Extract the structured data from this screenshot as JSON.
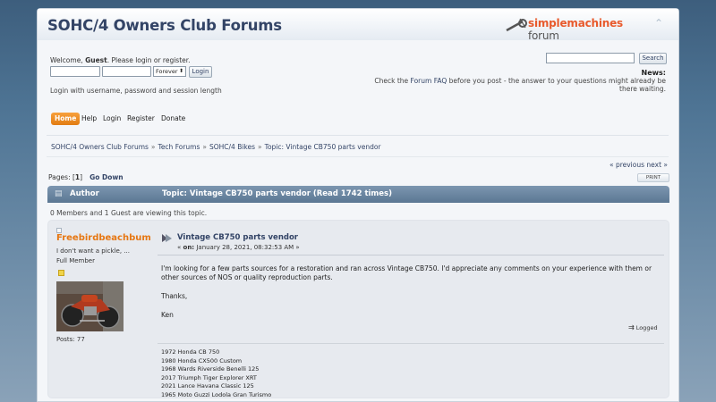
{
  "header": {
    "forum_title": "SOHC/4 Owners Club Forums",
    "logo_simple": "simple",
    "logo_machines": "machines",
    "logo_forum": " forum"
  },
  "user": {
    "welcome_prefix": "Welcome, ",
    "welcome_user": "Guest",
    "welcome_suffix": ". Please login or register.",
    "session_select": "Forever",
    "login_button": "Login",
    "session_note": "Login with username, password and session length"
  },
  "search": {
    "button": "Search"
  },
  "news": {
    "title": "News:",
    "text_1": "Check the ",
    "link": "Forum FAQ",
    "text_2": " before you post - the answer to your questions might already be there waiting."
  },
  "menu": {
    "items": [
      "Home",
      "Help",
      "Login",
      "Register",
      "Donate"
    ]
  },
  "breadcrumb": {
    "items": [
      "SOHC/4 Owners Club Forums",
      "Tech Forums",
      "SOHC/4 Bikes",
      "Topic: Vintage CB750 parts vendor"
    ],
    "sep": "»"
  },
  "nav": {
    "prev": "« previous",
    "next": "next »",
    "pages_label": "Pages: [",
    "current_page": "1",
    "pages_close": "]",
    "go_down": "Go Down",
    "print": "PRINT"
  },
  "topic_header": {
    "author_label": "Author",
    "topic_label": "Topic: Vintage CB750 parts vendor  (Read 1742 times)"
  },
  "viewing": "0 Members and 1 Guest are viewing this topic.",
  "post": {
    "poster_name": "Freebirdbeachbum",
    "poster_title": "I don't want a pickle, ...",
    "poster_group": "Full Member",
    "poster_posts": "Posts: 77",
    "subject": "Vintage CB750 parts vendor",
    "date_prefix": "« ",
    "date_on": "on:",
    "date_value": " January 28, 2021, 08:32:53 AM »",
    "body": [
      "I'm looking for a few parts sources for a restoration and ran across Vintage CB750. I'd appreciate any comments on your experience with them or other sources of NOS or quality reproduction parts.",
      "Thanks,",
      "Ken"
    ],
    "logged": "Logged",
    "signature": [
      "1972 Honda CB 750",
      "1980 Honda CX500 Custom",
      "1968 Wards Riverside Benelli 125",
      "2017 Triumph Tiger Explorer XRT",
      "2021 Lance Havana Classic 125",
      "1965 Moto Guzzi Lodola Gran Turismo"
    ]
  },
  "colors": {
    "accent_orange": "#e67713",
    "link_blue": "#334466",
    "header_bar": "#5b7793"
  }
}
